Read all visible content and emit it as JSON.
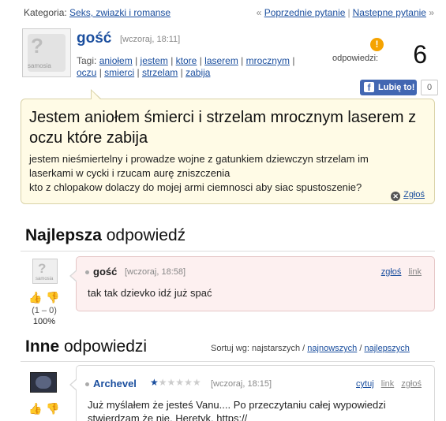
{
  "topbar": {
    "category_label": "Kategoria:",
    "category_link": "Seks, zwiazki i romanse",
    "nav_prev_arrow": "«",
    "nav_prev": "Poprzednie pytanie",
    "nav_sep": "|",
    "nav_next": "Nastepne pytanie",
    "nav_next_arrow": "»"
  },
  "question": {
    "avatar_brand": "samosia",
    "user": "gość",
    "time": "[wczoraj, 18:11]",
    "tags_label": "Tagi:",
    "tags": [
      "aniołem",
      "jestem",
      "ktore",
      "laserem",
      "mrocznym",
      "oczu",
      "smierci",
      "strzelam",
      "zabija"
    ],
    "answers_label": "odpowiedzi:",
    "answers_count": "6",
    "fb_label": "Lubię to!",
    "fb_count": "0",
    "title": "Jestem aniołem śmierci i strzelam mrocznym laserem z oczu które zabija",
    "body_line1": "jestem nieśmiertelny i prowadze wojne z gatunkiem dziewczyn strzelam im",
    "body_line2": "laserkami w cycki i rzucam aurę zniszczenia",
    "body_line3": "kto z chlopakow dolaczy do mojej armi ciemnosci aby siac spustoszenie?",
    "report": "Zgłoś"
  },
  "best": {
    "heading_bold": "Najlepsza",
    "heading_rest": " odpowiedź",
    "avatar_brand": "samosia",
    "vote_counts": "(1 – 0)",
    "vote_percent": "100%",
    "user": "gość",
    "time": "[wczoraj, 18:58]",
    "action_report": "zgłoś",
    "action_link": "link",
    "text": "tak tak dzievko idź już spać"
  },
  "others": {
    "heading_bold": "Inne",
    "heading_rest": " odpowiedzi",
    "sort_label": "Sortuj wg:",
    "sort_oldest": "najstarszych",
    "sort_newest": "najnowszych",
    "sort_best": "najlepszych",
    "first": {
      "user": "Archevel",
      "rank_stars": 1,
      "time": "[wczoraj, 18:15]",
      "action_quote": "cytuj",
      "action_link": "link",
      "action_report": "zgłoś",
      "text_line1": "Już myślałem że jesteś Vanu.... Po przeczytaniu całej wypowiedzi",
      "text_line2": "stwierdzam że nie. Heretyk. https://"
    }
  },
  "icons": {
    "answers": "exclamation-icon",
    "report": "close-icon",
    "vote_up": "thumb-up-icon",
    "vote_down": "thumb-down-icon",
    "rank": "star-icon"
  },
  "colors": {
    "link": "#1a4e9e",
    "bubble_bg": "#fffbe6",
    "best_bg": "#fdf0f0",
    "accent": "#f5a300",
    "fb": "#4267b2"
  }
}
